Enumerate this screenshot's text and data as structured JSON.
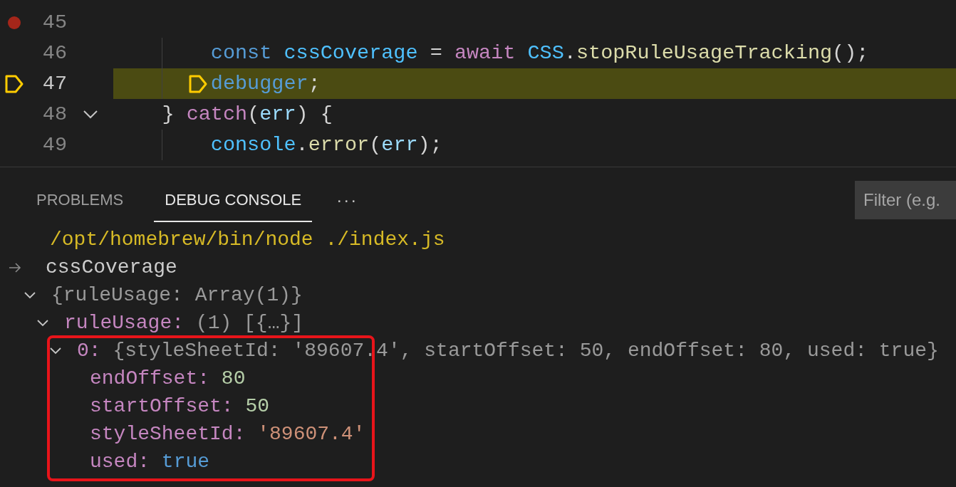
{
  "editor": {
    "lines": [
      {
        "number": "45",
        "breakpoint": true,
        "paused": false,
        "foldable": false
      },
      {
        "number": "46",
        "breakpoint": false,
        "paused": false,
        "foldable": false,
        "tokens": [
          {
            "kind": "kw",
            "text": "        const "
          },
          {
            "kind": "var",
            "text": "cssCoverage"
          },
          {
            "kind": "plain",
            "text": " = "
          },
          {
            "kind": "ctrl",
            "text": "await "
          },
          {
            "kind": "var",
            "text": "CSS"
          },
          {
            "kind": "plain",
            "text": "."
          },
          {
            "kind": "fn",
            "text": "stopRuleUsageTracking"
          },
          {
            "kind": "plain",
            "text": "();"
          }
        ]
      },
      {
        "number": "47",
        "breakpoint": false,
        "paused": true,
        "foldable": false,
        "tokens": [
          {
            "kind": "kw",
            "text": "        debugger"
          },
          {
            "kind": "plain",
            "text": ";"
          }
        ]
      },
      {
        "number": "48",
        "breakpoint": false,
        "paused": false,
        "foldable": true,
        "expanded": true,
        "tokens": [
          {
            "kind": "plain",
            "text": "    } "
          },
          {
            "kind": "ctrl",
            "text": "catch"
          },
          {
            "kind": "plain",
            "text": "("
          },
          {
            "kind": "param",
            "text": "err"
          },
          {
            "kind": "plain",
            "text": ") {"
          }
        ]
      },
      {
        "number": "49",
        "breakpoint": false,
        "paused": false,
        "foldable": false,
        "tokens": [
          {
            "kind": "var",
            "text": "        console"
          },
          {
            "kind": "plain",
            "text": "."
          },
          {
            "kind": "fn",
            "text": "error"
          },
          {
            "kind": "plain",
            "text": "("
          },
          {
            "kind": "param",
            "text": "err"
          },
          {
            "kind": "plain",
            "text": ");"
          }
        ]
      }
    ]
  },
  "panel": {
    "tabs": [
      {
        "label": "PROBLEMS",
        "selected": false
      },
      {
        "label": "DEBUG CONSOLE",
        "selected": true
      }
    ],
    "more": "···",
    "filter": {
      "placeholder": "Filter (e.g."
    },
    "console": {
      "launch_line": "/opt/homebrew/bin/node ./index.js",
      "input": "cssCoverage",
      "tree": [
        {
          "value": "{ruleUsage: Array(1)}",
          "kind": "summary",
          "expanded": true,
          "highlighted": false,
          "children": [
            {
              "key": "ruleUsage:",
              "value": "(1) [{…}]",
              "kind": "summary",
              "expanded": true,
              "highlighted": false,
              "children": [
                {
                  "key": "0:",
                  "value": "{styleSheetId: '89607.4', startOffset: 50, endOffset: 80, used: true}",
                  "kind": "summary",
                  "expanded": true,
                  "highlighted": true,
                  "children": [
                    {
                      "key": "endOffset:",
                      "value": "80",
                      "kind": "number"
                    },
                    {
                      "key": "startOffset:",
                      "value": "50",
                      "kind": "number"
                    },
                    {
                      "key": "styleSheetId:",
                      "value": "'89607.4'",
                      "kind": "string"
                    },
                    {
                      "key": "used:",
                      "value": "true",
                      "kind": "boolean"
                    }
                  ]
                }
              ]
            }
          ]
        }
      ]
    }
  }
}
